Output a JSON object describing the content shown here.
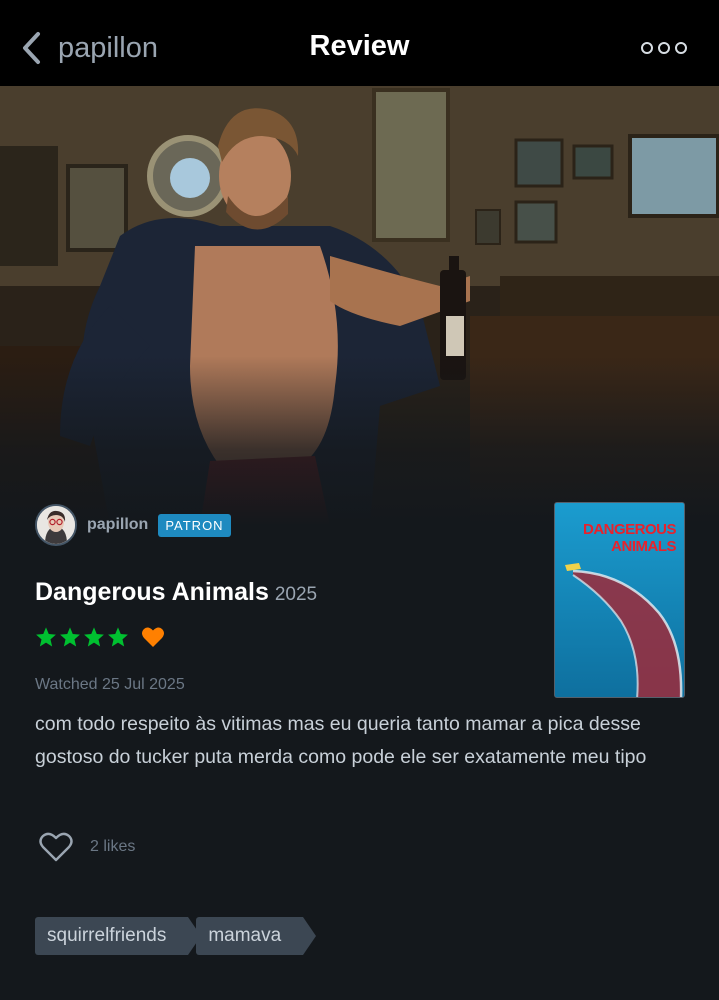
{
  "nav": {
    "back_label": "papillon",
    "title": "Review",
    "more_icon": "ellipsis-icon"
  },
  "reviewer": {
    "username": "papillon",
    "badge": "PATRON"
  },
  "film": {
    "title": "Dangerous Animals",
    "year": "2025",
    "poster_text": "DANGEROUS ANIMALS",
    "rating_stars": 4,
    "liked": true
  },
  "review": {
    "watched": "Watched 25 Jul 2025",
    "text": "com todo respeito às vitimas mas eu queria tanto mamar a pica desse gostoso do tucker puta merda como pode ele ser exatamente meu tipo"
  },
  "likes": {
    "count_label": "2 likes"
  },
  "tags": [
    "squirrelfriends",
    "mamava"
  ],
  "colors": {
    "background": "#14181c",
    "star_green": "#00c030",
    "heart_orange": "#ff8000",
    "badge_blue": "#1e8ac0",
    "tag_bg": "#3c4753"
  }
}
